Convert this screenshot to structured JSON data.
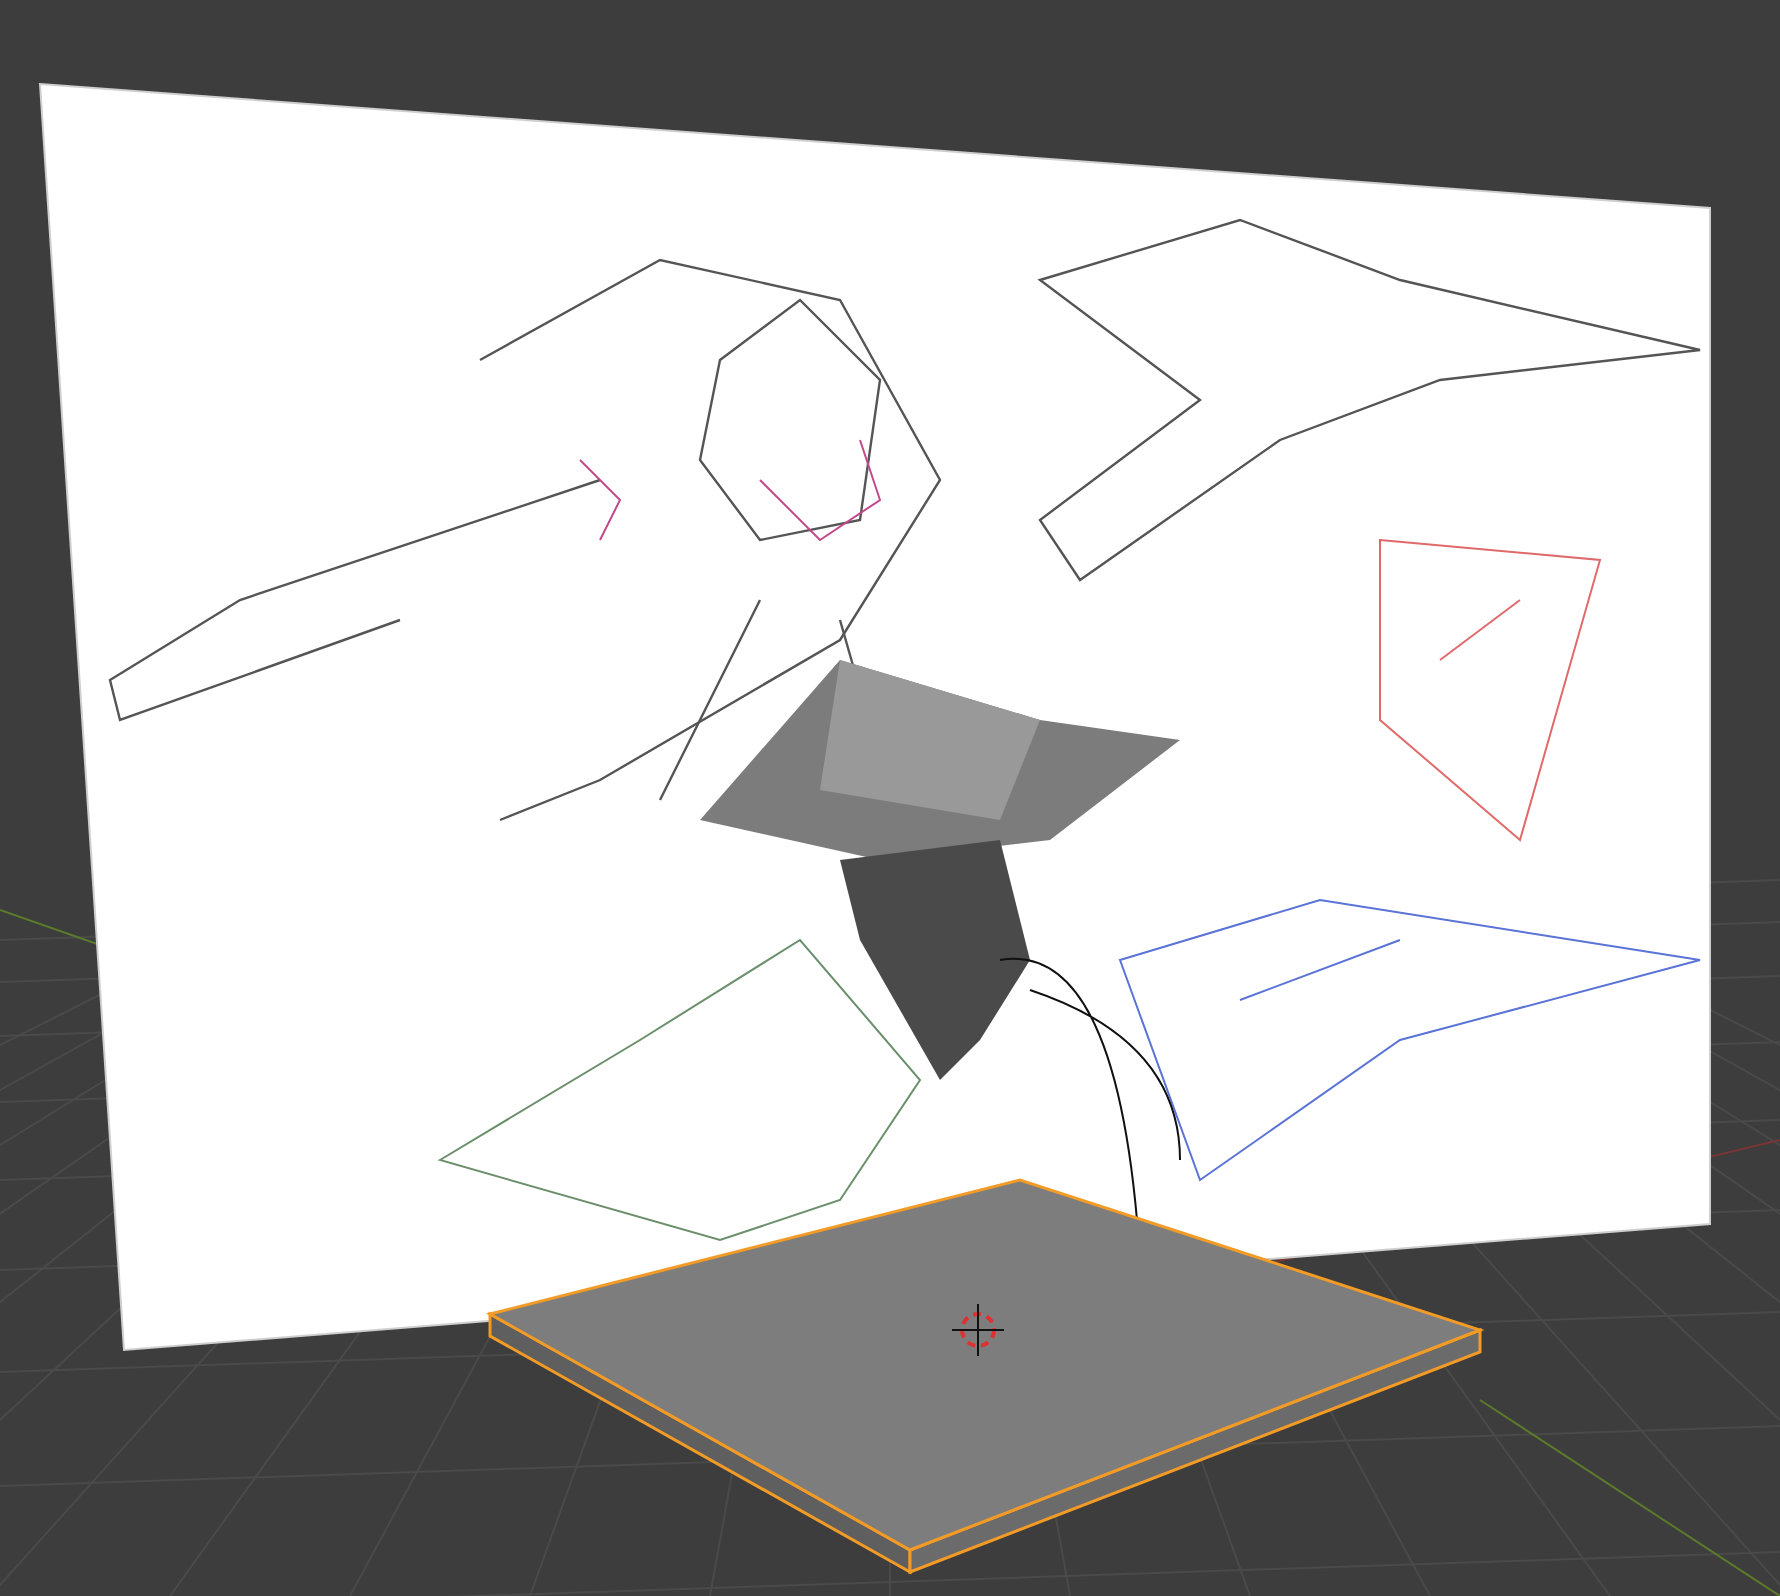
{
  "viewport": {
    "objects": [
      {
        "kind": "reference-sheet"
      },
      {
        "kind": "model"
      },
      {
        "kind": "plane",
        "selected": true
      }
    ]
  }
}
